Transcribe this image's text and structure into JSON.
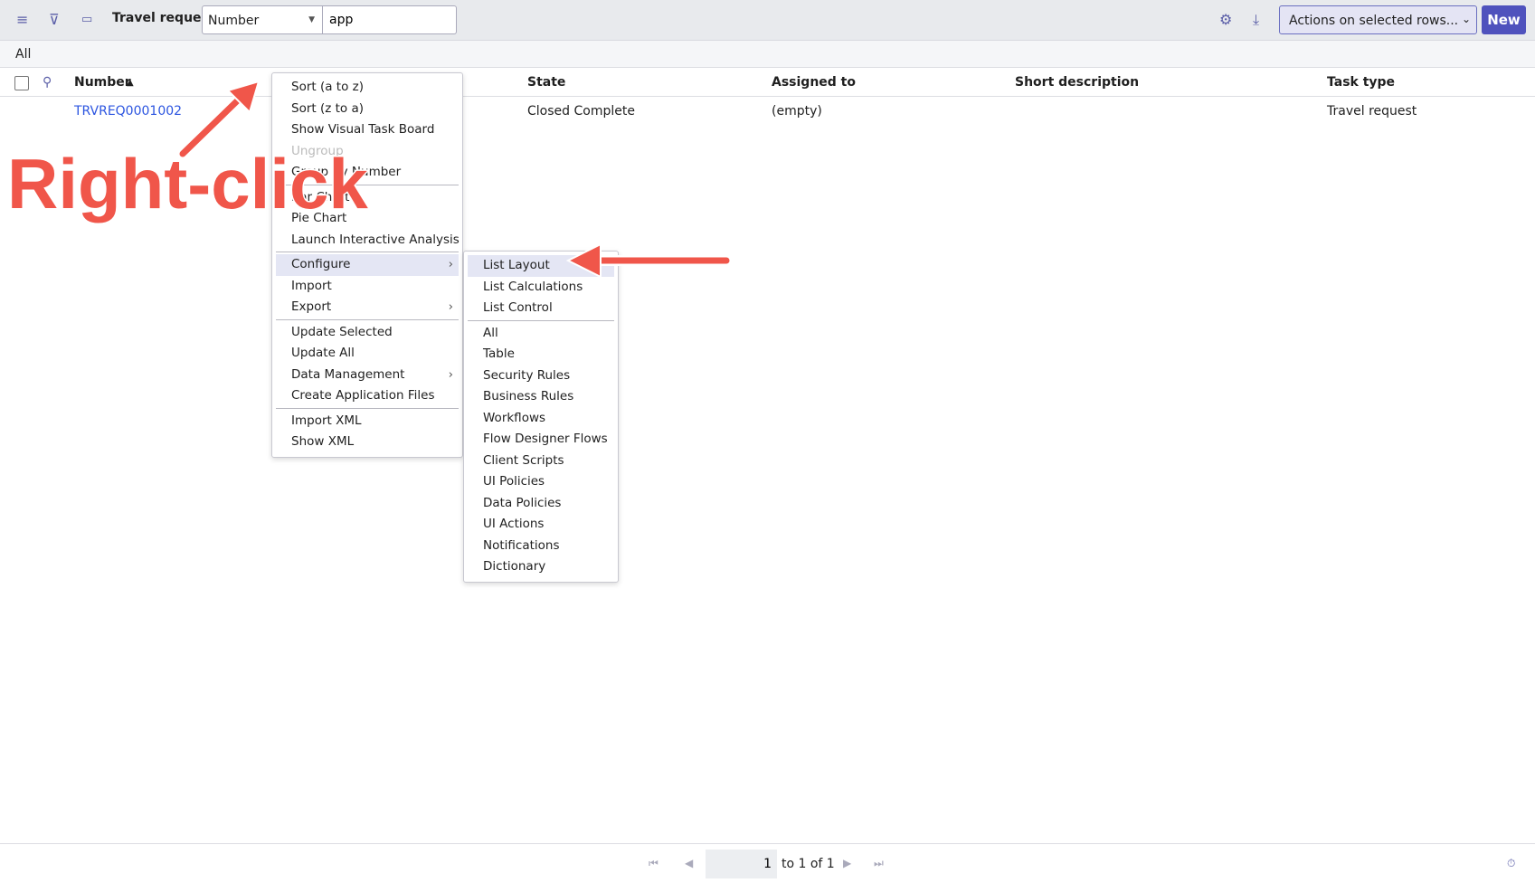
{
  "header": {
    "title": "Travel requests",
    "search_field": "Number",
    "search_value": "app",
    "actions_select": "Actions on selected rows...",
    "new_label": "New",
    "icons": [
      "menu-icon",
      "filter-icon",
      "comment-icon",
      "gear-icon",
      "download-icon"
    ]
  },
  "filter_breadcrumb": "All",
  "columns": [
    "Number",
    "State",
    "Assigned to",
    "Short description",
    "Task type"
  ],
  "rows": [
    {
      "number": "TRVREQ0001002",
      "state": "Closed Complete",
      "assigned_to": "(empty)",
      "short_description": "",
      "task_type": "Travel request"
    }
  ],
  "context_menu": {
    "items": [
      "Sort (a to z)",
      "Sort (z to a)",
      "Show Visual Task Board",
      "Ungroup",
      "Group By Number",
      "Bar Chart",
      "Pie Chart",
      "Launch Interactive Analysis",
      "Configure",
      "Import",
      "Export",
      "Update Selected",
      "Update All",
      "Data Management",
      "Create Application Files",
      "Import XML",
      "Show XML"
    ]
  },
  "submenu": {
    "items": [
      "List Layout",
      "List Calculations",
      "List Control",
      "All",
      "Table",
      "Security Rules",
      "Business Rules",
      "Workflows",
      "Flow Designer Flows",
      "Client Scripts",
      "UI Policies",
      "Data Policies",
      "UI Actions",
      "Notifications",
      "Dictionary"
    ]
  },
  "annotation": {
    "text": "Right-click",
    "color": "#f0564a"
  },
  "pagination": {
    "page": "1",
    "range": "to 1 of 1"
  },
  "colors": {
    "accent": "#4f52bd",
    "link": "#2c55e0",
    "highlight": "#e4e6f4"
  }
}
